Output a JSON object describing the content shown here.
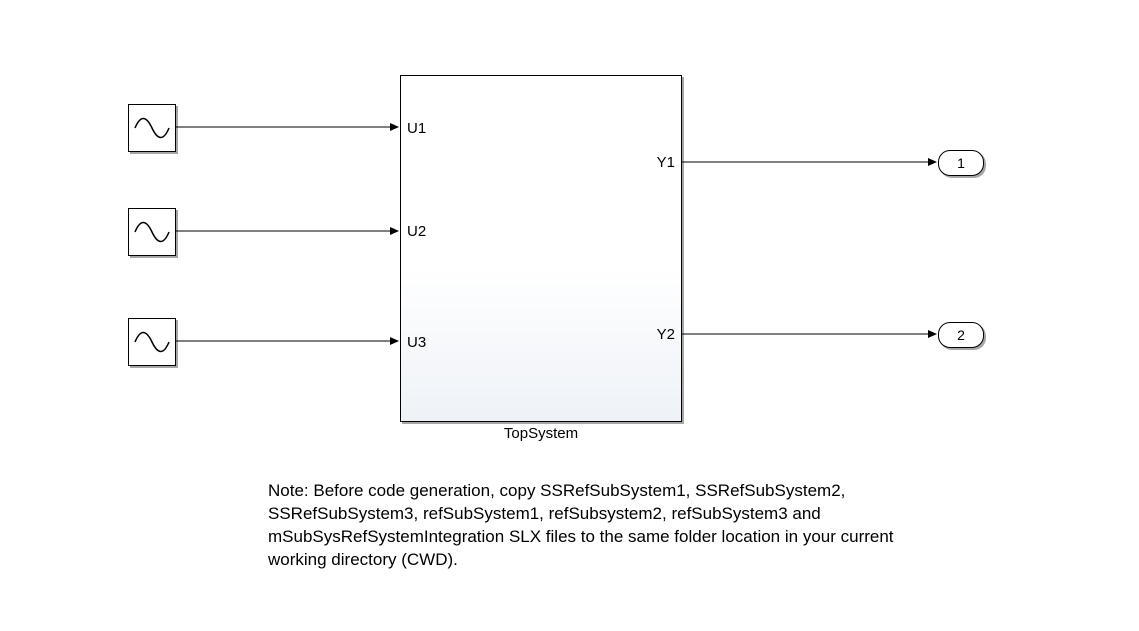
{
  "sources": [
    {
      "type": "sine-wave"
    },
    {
      "type": "sine-wave"
    },
    {
      "type": "sine-wave"
    }
  ],
  "subsystem": {
    "name": "TopSystem",
    "input_ports": [
      "U1",
      "U2",
      "U3"
    ],
    "output_ports": [
      "Y1",
      "Y2"
    ]
  },
  "outports": [
    {
      "label": "1"
    },
    {
      "label": "2"
    }
  ],
  "note_text": "Note: Before code generation, copy SSRefSubSystem1, SSRefSubSystem2, SSRefSubSystem3, refSubSystem1, refSubsystem2, refSubSystem3 and mSubSysRefSystemIntegration SLX files to the same folder location in your current working directory (CWD)."
}
